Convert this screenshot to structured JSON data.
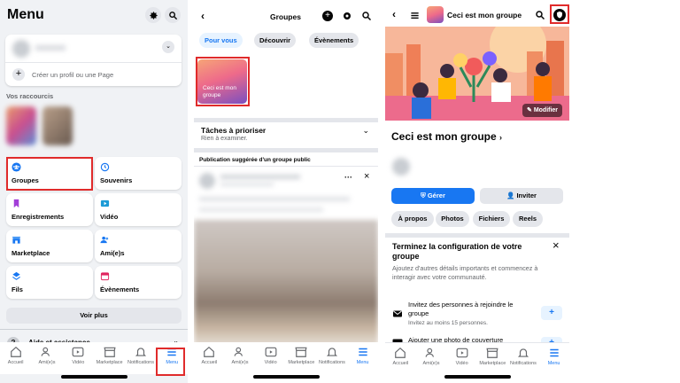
{
  "p1": {
    "title": "Menu",
    "create_profile": "Créer un profil ou une Page",
    "shortcuts": "Vos raccourcis",
    "tiles": [
      "Groupes",
      "Souvenirs",
      "Enregistrements",
      "Vidéo",
      "Marketplace",
      "Ami(e)s",
      "Fils",
      "Évènements"
    ],
    "see_more": "Voir plus",
    "help": "Aide et assistance"
  },
  "p2": {
    "title": "Groupes",
    "pills": [
      "Pour vous",
      "Découvrir",
      "Évènements"
    ],
    "group_thumb": "Ceci est mon groupe",
    "tasks_title": "Tâches à prioriser",
    "tasks_sub": "Rien à examiner.",
    "suggested": "Publication suggérée d'un groupe public"
  },
  "p3": {
    "group_name": "Ceci est mon groupe",
    "modifier": "Modifier",
    "gerer": "Gérer",
    "inviter": "Inviter",
    "chips": [
      "À propos",
      "Photos",
      "Fichiers",
      "Reels"
    ],
    "setup_title": "Terminez la configuration de votre groupe",
    "setup_desc": "Ajoutez d'autres détails importants et commencez à interagir avec votre communauté.",
    "invite_title": "Invitez des personnes à rejoindre le groupe",
    "invite_sub": "Invitez au moins 15 personnes.",
    "cover": "Ajouter une photo de couverture"
  },
  "tabs": [
    "Accueil",
    "Ami(e)s",
    "Vidéo",
    "Marketplace",
    "Notifications",
    "Menu"
  ],
  "colors": {
    "accent": "#1877f2",
    "highlight": "#e02b2b"
  }
}
